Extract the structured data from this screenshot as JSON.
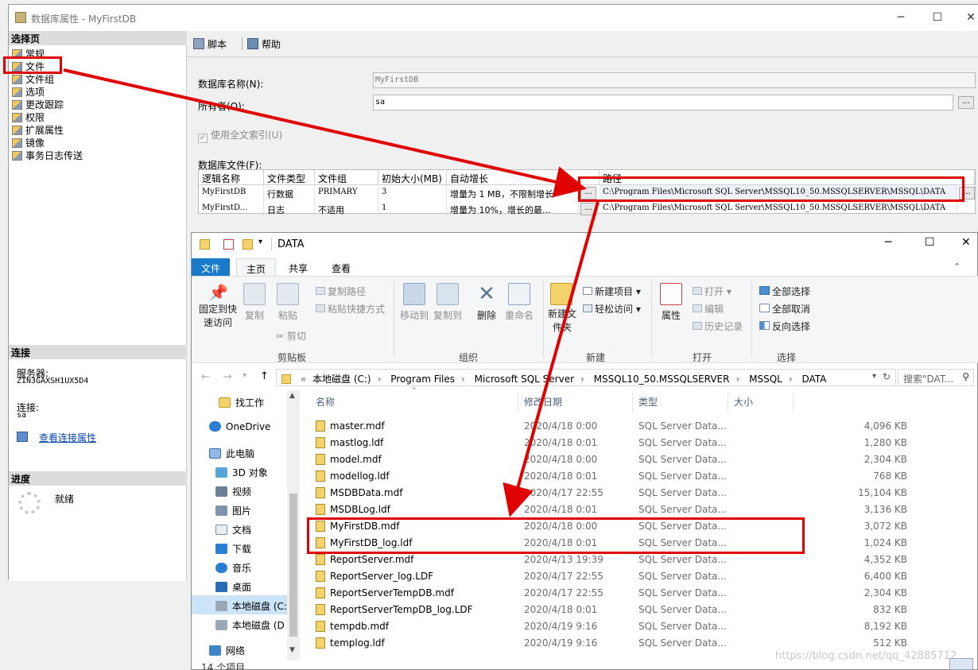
{
  "dialog": {
    "title": "数据库属性 - MyFirstDB",
    "select_page_header": "选择页",
    "nav_items": [
      "常规",
      "文件",
      "文件组",
      "选项",
      "更改跟踪",
      "权限",
      "扩展属性",
      "镜像",
      "事务日志传送"
    ],
    "connection_header": "连接",
    "server_label": "服务器:",
    "server_value": "ZIN3GAXSH1UX5D4",
    "connection_label": "连接:",
    "connection_value": "sa",
    "view_conn_props": "查看连接属性",
    "progress_header": "进度",
    "progress_status": "就绪",
    "toolbar": {
      "script": "脚本",
      "help": "帮助"
    },
    "db_name_label": "数据库名称(N):",
    "db_name_value": "MyFirstDB",
    "owner_label": "所有者(O):",
    "owner_value": "sa",
    "ellipsis": "...",
    "fulltext_label": "使用全文索引(U)",
    "db_files_label": "数据库文件(F):",
    "grid_headers": [
      "逻辑名称",
      "文件类型",
      "文件组",
      "初始大小(MB)",
      "自动增长",
      "路径"
    ],
    "grid_rows": [
      {
        "logical": "MyFirstDB",
        "type": "行数据",
        "group": "PRIMARY",
        "size": "3",
        "growth": "增量为 1 MB，不限制增长",
        "path": "C:\\Program Files\\Microsoft SQL Server\\MSSQL10_50.MSSQLSERVER\\MSSQL\\DATA"
      },
      {
        "logical": "MyFirstD...",
        "type": "日志",
        "group": "不适用",
        "size": "1",
        "growth": "增量为 10%，增长的最...",
        "path": "C:\\Program Files\\Microsoft SQL Server\\MSSQL10_50.MSSQLSERVER\\MSSQL\\DATA"
      }
    ]
  },
  "explorer": {
    "title": "DATA",
    "tabs": [
      "文件",
      "主页",
      "共享",
      "查看"
    ],
    "ribbon": {
      "pin": "固定到快速访问",
      "copy": "复制",
      "paste": "粘贴",
      "copy_path": "复制路径",
      "paste_shortcut": "粘贴快捷方式",
      "cut": "剪切",
      "clipboard": "剪贴板",
      "move_to": "移动到",
      "copy_to": "复制到",
      "delete": "删除",
      "rename": "重命名",
      "organize": "组织",
      "new_folder": "新建文件夹",
      "new_item": "新建项目",
      "easy_access": "轻松访问",
      "new": "新建",
      "properties": "属性",
      "open": "打开",
      "edit": "编辑",
      "history": "历史记录",
      "open_group": "打开",
      "select_all": "全部选择",
      "select_none": "全部取消",
      "invert": "反向选择",
      "select": "选择"
    },
    "breadcrumb": [
      "本地磁盘 (C:)",
      "Program Files",
      "Microsoft SQL Server",
      "MSSQL10_50.MSSQLSERVER",
      "MSSQL",
      "DATA"
    ],
    "search_placeholder": "搜索\"DAT...",
    "nav": [
      "找工作",
      "OneDrive",
      "此电脑",
      "3D 对象",
      "视频",
      "图片",
      "文档",
      "下载",
      "音乐",
      "桌面",
      "本地磁盘 (C:",
      "本地磁盘 (D",
      "网络"
    ],
    "columns": [
      "名称",
      "修改日期",
      "类型",
      "大小"
    ],
    "files": [
      {
        "name": "master.mdf",
        "date": "2020/4/18 0:00",
        "type": "SQL Server Data...",
        "size": "4,096 KB"
      },
      {
        "name": "mastlog.ldf",
        "date": "2020/4/18 0:01",
        "type": "SQL Server Data...",
        "size": "1,280 KB"
      },
      {
        "name": "model.mdf",
        "date": "2020/4/18 0:00",
        "type": "SQL Server Data...",
        "size": "2,304 KB"
      },
      {
        "name": "modellog.ldf",
        "date": "2020/4/18 0:01",
        "type": "SQL Server Data...",
        "size": "768 KB"
      },
      {
        "name": "MSDBData.mdf",
        "date": "2020/4/17 22:55",
        "type": "SQL Server Data...",
        "size": "15,104 KB"
      },
      {
        "name": "MSDBLog.ldf",
        "date": "2020/4/18 0:01",
        "type": "SQL Server Data...",
        "size": "3,136 KB"
      },
      {
        "name": "MyFirstDB.mdf",
        "date": "2020/4/18 0:00",
        "type": "SQL Server Data...",
        "size": "3,072 KB"
      },
      {
        "name": "MyFirstDB_log.ldf",
        "date": "2020/4/18 0:01",
        "type": "SQL Server Data...",
        "size": "1,024 KB"
      },
      {
        "name": "ReportServer.mdf",
        "date": "2020/4/13 19:39",
        "type": "SQL Server Data...",
        "size": "4,352 KB"
      },
      {
        "name": "ReportServer_log.LDF",
        "date": "2020/4/17 22:55",
        "type": "SQL Server Data...",
        "size": "6,400 KB"
      },
      {
        "name": "ReportServerTempDB.mdf",
        "date": "2020/4/17 22:55",
        "type": "SQL Server Data...",
        "size": "2,304 KB"
      },
      {
        "name": "ReportServerTempDB_log.LDF",
        "date": "2020/4/18 0:01",
        "type": "SQL Server Data...",
        "size": "832 KB"
      },
      {
        "name": "tempdb.mdf",
        "date": "2020/4/19 9:16",
        "type": "SQL Server Data...",
        "size": "8,192 KB"
      },
      {
        "name": "templog.ldf",
        "date": "2020/4/19 9:16",
        "type": "SQL Server Data...",
        "size": "512 KB"
      }
    ],
    "item_count": "14 个项目"
  },
  "watermark": "https://blog.csdn.net/qq_42885712",
  "colors": {
    "annotation_red": "#e00000",
    "explorer_accent": "#1979ca"
  }
}
